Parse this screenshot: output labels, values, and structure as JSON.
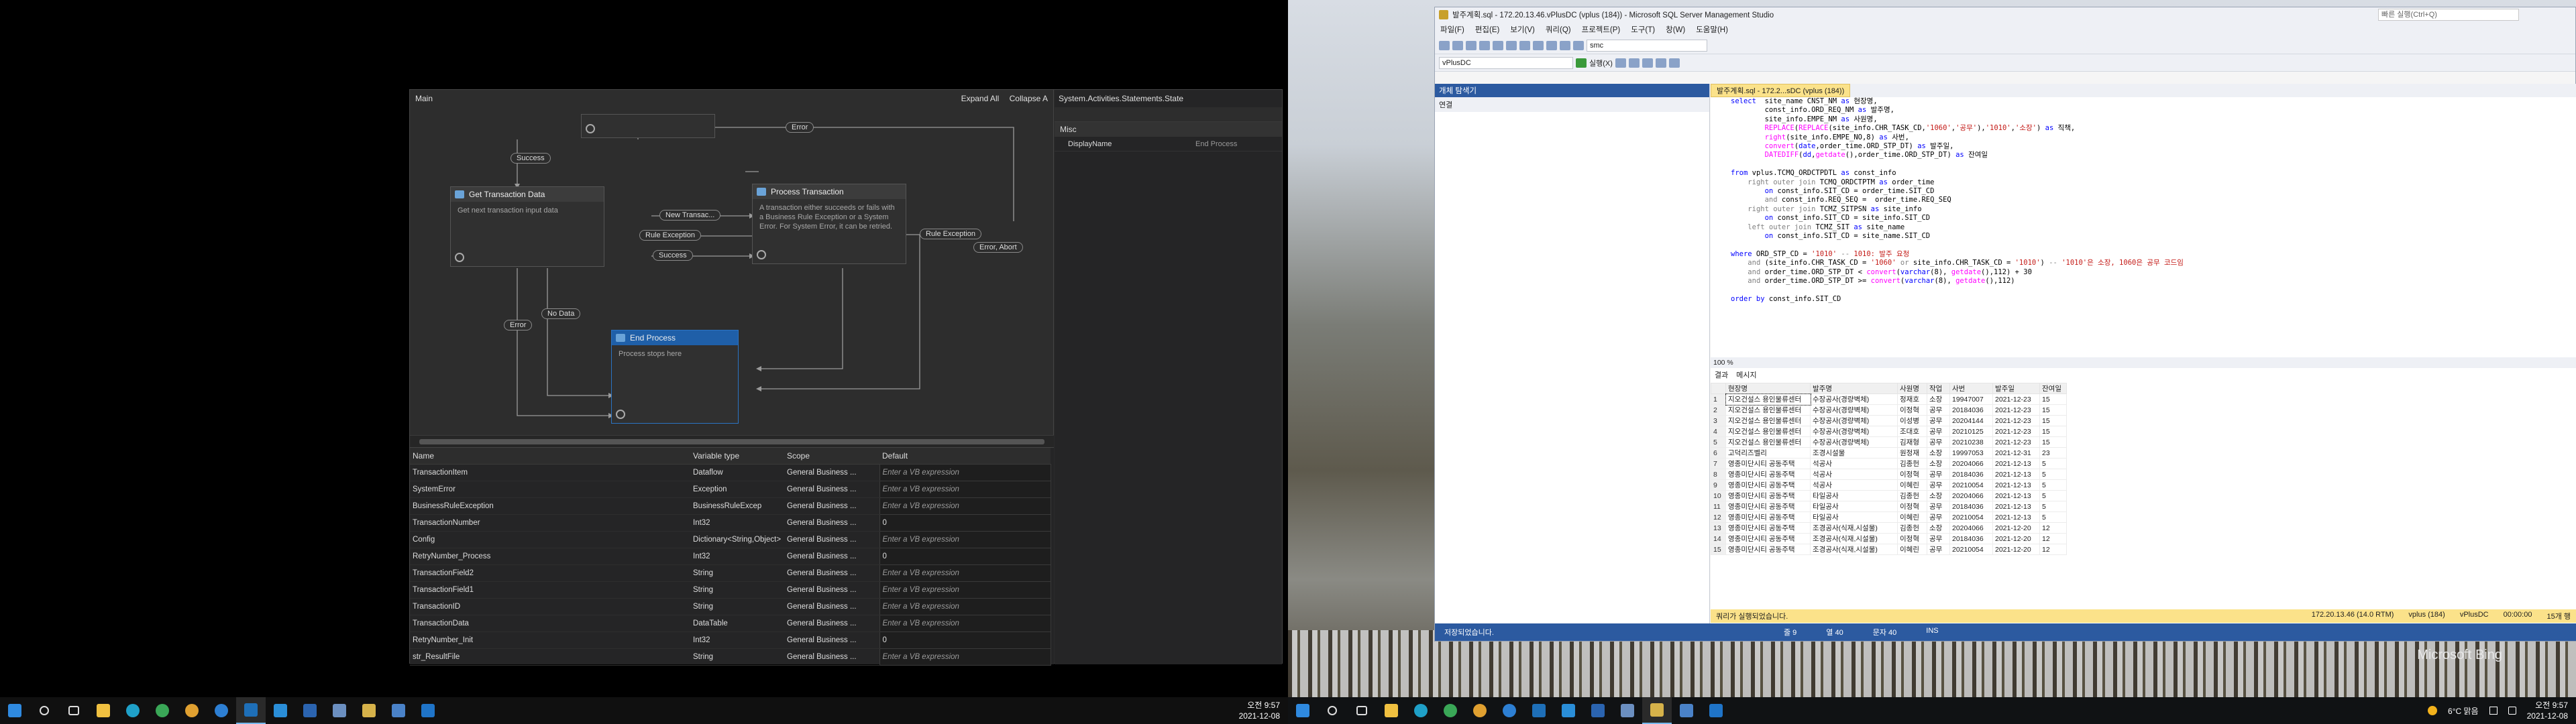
{
  "uipath": {
    "designer_title": "Main",
    "expand_all": "Expand All",
    "collapse_all": "Collapse A",
    "states": {
      "get_transaction": {
        "title": "Get Transaction Data",
        "desc": "Get next transaction input data"
      },
      "process": {
        "title": "Process Transaction",
        "desc": "A transaction either succeeds or fails with a Business Rule Exception or a System Error. For System Error, it can be retried."
      },
      "end": {
        "title": "End Process",
        "desc": "Process stops here"
      }
    },
    "transitions": {
      "success_top": "Success",
      "error_top": "Error",
      "new_transaction": "New Transac...",
      "rule_exception": "Rule Exception",
      "success_mid": "Success",
      "rule_exception_right": "Rule Exception",
      "error_abort": "Error, Abort",
      "error_left": "Error",
      "no_data": "No Data"
    },
    "properties": {
      "title": "System.Activities.Statements.State",
      "category": "Misc",
      "rows": [
        {
          "key": "DisplayName",
          "value": "End Process"
        }
      ]
    },
    "variables": {
      "headers": [
        "Name",
        "Variable type",
        "Scope",
        "Default"
      ],
      "rows": [
        {
          "name": "TransactionItem",
          "type": "Dataflow",
          "scope": "General Business ...",
          "default": "Enter a VB expression"
        },
        {
          "name": "SystemError",
          "type": "Exception",
          "scope": "General Business ...",
          "default": "Enter a VB expression"
        },
        {
          "name": "BusinessRuleException",
          "type": "BusinessRuleExcep",
          "scope": "General Business ...",
          "default": "Enter a VB expression"
        },
        {
          "name": "TransactionNumber",
          "type": "Int32",
          "scope": "General Business ...",
          "default": "0"
        },
        {
          "name": "Config",
          "type": "Dictionary<String,Object>",
          "scope": "General Business ...",
          "default": "Enter a VB expression"
        },
        {
          "name": "RetryNumber_Process",
          "type": "Int32",
          "scope": "General Business ...",
          "default": "0"
        },
        {
          "name": "TransactionField2",
          "type": "String",
          "scope": "General Business ...",
          "default": "Enter a VB expression"
        },
        {
          "name": "TransactionField1",
          "type": "String",
          "scope": "General Business ...",
          "default": "Enter a VB expression"
        },
        {
          "name": "TransactionID",
          "type": "String",
          "scope": "General Business ...",
          "default": "Enter a VB expression"
        },
        {
          "name": "TransactionData",
          "type": "DataTable",
          "scope": "General Business ...",
          "default": "Enter a VB expression"
        },
        {
          "name": "RetryNumber_Init",
          "type": "Int32",
          "scope": "General Business ...",
          "default": "0"
        },
        {
          "name": "str_ResultFile",
          "type": "String",
          "scope": "General Business ...",
          "default": "Enter a VB expression"
        }
      ]
    }
  },
  "taskbar_left": {
    "time": "오전 9:57",
    "date": "2021-12-08"
  },
  "ssms": {
    "title": "발주계획.sql - 172.20.13.46.vPlusDC (vplus (184)) - Microsoft SQL Server Management Studio",
    "quick_launch": "빠른 실행(Ctrl+Q)",
    "menu": [
      "파일(F)",
      "편집(E)",
      "보기(V)",
      "쿼리(Q)",
      "프로젝트(P)",
      "도구(T)",
      "창(W)",
      "도움말(H)"
    ],
    "db_combo": "vPlusDC",
    "execute": "실행(X)",
    "search_combo": "smc",
    "object_explorer_title": "개체 탐색기",
    "connect": "연결",
    "tab_label": "발주계획.sql - 172.2...sDC (vplus (184))",
    "zoom": "100 %",
    "result_tabs": [
      "결과",
      "메시지"
    ],
    "status_message": "쿼리가 실행되었습니다.",
    "status_right": [
      "172.20.13.46 (14.0 RTM)",
      "vplus (184)",
      "vPlusDC",
      "00:00:00",
      "15개 행"
    ],
    "app_status": "저장되었습니다.",
    "app_status_pos": [
      "줄 9",
      "열 40",
      "문자 40",
      "INS"
    ],
    "grid": {
      "headers": [
        "",
        "현장명",
        "발주명",
        "사원명",
        "작업",
        "사번",
        "발주일",
        "잔여일"
      ],
      "rows": [
        [
          "1",
          "지오건설스 용인물류센터",
          "수장공사(경량벽체)",
          "정재호",
          "소장",
          "19947007",
          "2021-12-23",
          "15"
        ],
        [
          "2",
          "지오건설스 용인물류센터",
          "수장공사(경량벽체)",
          "이정혁",
          "공무",
          "20184036",
          "2021-12-23",
          "15"
        ],
        [
          "3",
          "지오건설스 용인물류센터",
          "수장공사(경량벽체)",
          "이성병",
          "공무",
          "20204144",
          "2021-12-23",
          "15"
        ],
        [
          "4",
          "지오건설스 용인물류센터",
          "수장공사(경량벽체)",
          "조대호",
          "공무",
          "20210125",
          "2021-12-23",
          "15"
        ],
        [
          "5",
          "지오건설스 용인물류센터",
          "수장공사(경량벽체)",
          "김재형",
          "공무",
          "20210238",
          "2021-12-23",
          "15"
        ],
        [
          "6",
          "고덕리즈벨리",
          "조경시설물",
          "원정재",
          "소장",
          "19997053",
          "2021-12-31",
          "23"
        ],
        [
          "7",
          "영종미단시티 공동주택",
          "석공사",
          "김종헌",
          "소장",
          "20204066",
          "2021-12-13",
          "5"
        ],
        [
          "8",
          "영종미단시티 공동주택",
          "석공사",
          "이정혁",
          "공무",
          "20184036",
          "2021-12-13",
          "5"
        ],
        [
          "9",
          "영종미단시티 공동주택",
          "석공사",
          "이혜린",
          "공무",
          "20210054",
          "2021-12-13",
          "5"
        ],
        [
          "10",
          "영종미단시티 공동주택",
          "타일공사",
          "김종헌",
          "소장",
          "20204066",
          "2021-12-13",
          "5"
        ],
        [
          "11",
          "영종미단시티 공동주택",
          "타일공사",
          "이정혁",
          "공무",
          "20184036",
          "2021-12-13",
          "5"
        ],
        [
          "12",
          "영종미단시티 공동주택",
          "타일공사",
          "이혜린",
          "공무",
          "20210054",
          "2021-12-13",
          "5"
        ],
        [
          "13",
          "영종미단시티 공동주택",
          "조경공사(식재,시설물)",
          "김종헌",
          "소장",
          "20204066",
          "2021-12-20",
          "12"
        ],
        [
          "14",
          "영종미단시티 공동주택",
          "조경공사(식재,시설물)",
          "이정혁",
          "공무",
          "20184036",
          "2021-12-20",
          "12"
        ],
        [
          "15",
          "영종미단시티 공동주택",
          "조경공사(식재,시설물)",
          "이혜린",
          "공무",
          "20210054",
          "2021-12-20",
          "12"
        ]
      ]
    }
  },
  "desktop2": {
    "watermark": "Microsoft Bing"
  },
  "taskbar_right": {
    "weather": "6°C 맑음",
    "time": "오전 9:57",
    "date": "2021-12-08"
  },
  "colors": {
    "uipath_bg": "#2d2d2d",
    "ssms_accent": "#2c5aa0",
    "ssms_tab": "#fbe28a"
  }
}
